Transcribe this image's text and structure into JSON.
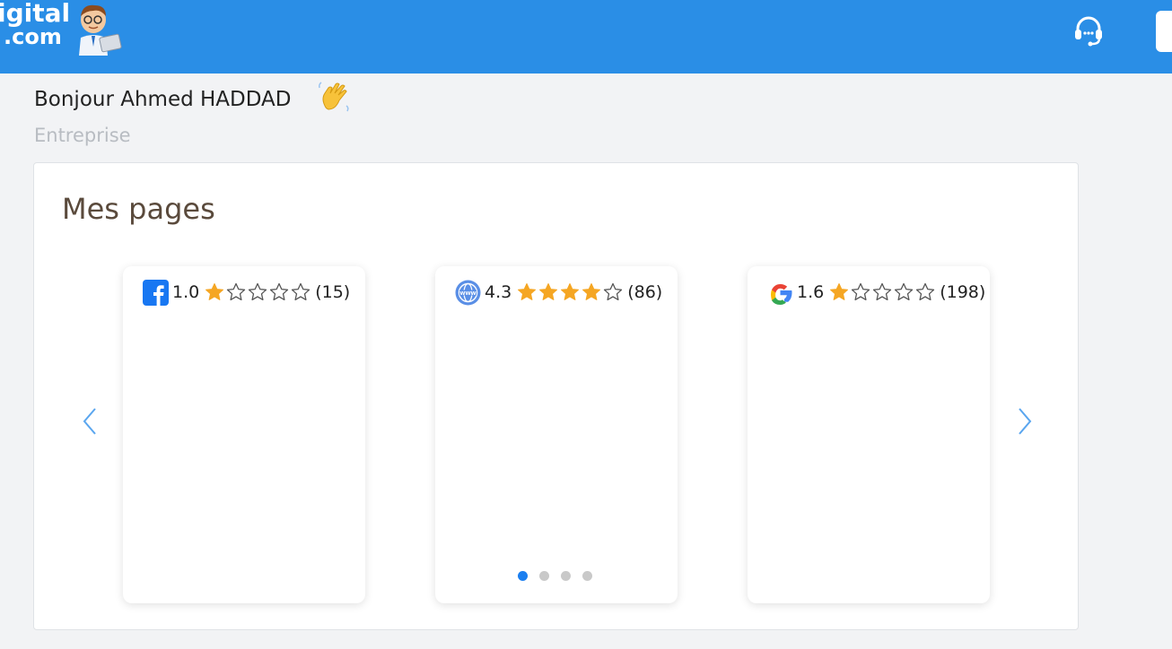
{
  "header": {
    "logo_line1": "igital",
    "logo_line2": ".com",
    "mascot_icon": "mascot-icon",
    "support_icon": "headset-icon",
    "bg_color": "#2a8ee6"
  },
  "greeting": {
    "text": "Bonjour Ahmed HADDAD",
    "emoji_icon": "waving-hand-icon",
    "role": "Entreprise"
  },
  "pages_panel": {
    "title": "Mes pages",
    "prev_icon": "chevron-left-icon",
    "next_icon": "chevron-right-icon",
    "cards": [
      {
        "source_icon": "facebook-icon",
        "score": "1.0",
        "stars_filled": 1,
        "stars_total": 5,
        "count": "(15)"
      },
      {
        "source_icon": "website-globe-icon",
        "score": "4.3",
        "stars_filled": 4,
        "stars_total": 5,
        "count": "(86)"
      },
      {
        "source_icon": "google-icon",
        "score": "1.6",
        "stars_filled": 1,
        "stars_total": 5,
        "count": "(198)"
      }
    ],
    "carousel_dots": 4,
    "carousel_active_index": 0
  },
  "colors": {
    "accent": "#2a8ee6",
    "star": "#f5a623",
    "dot_active": "#1b7ff0",
    "dot_inactive": "#c9c9c9"
  }
}
